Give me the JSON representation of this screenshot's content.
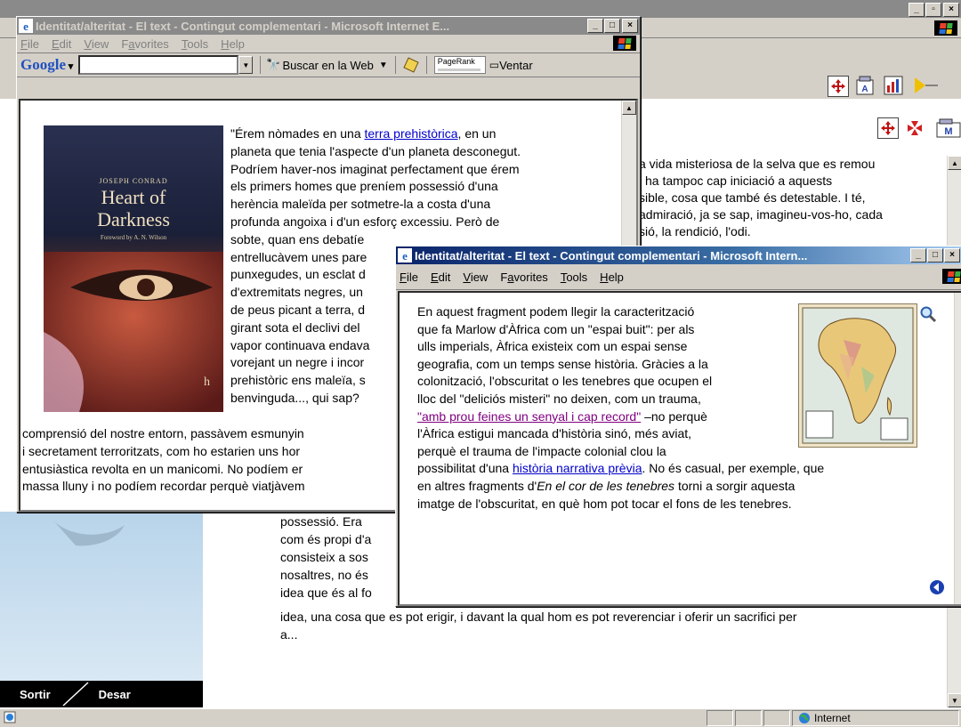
{
  "back_window": {
    "right_text": [
      "a vida misteriosa de la selva que es remou",
      "i ha tampoc cap iniciació a aquests",
      "sible, cosa que també és detestable. I té,",
      "admiració, ja se sap, imagineu-vos-ho, cada",
      "sió, la rendició, l'odi."
    ],
    "lower_text": [
      "possessió. Era",
      "com és propi d'a",
      "consisteix a sos",
      "nosaltres, no és",
      "idea que és al fo"
    ],
    "bottom_line": "idea, una cosa que es pot erigir, i davant la qual hom es pot reverenciar i oferir un sacrifici per",
    "bottom_line2": "a...",
    "btn_sortir": "Sortir",
    "btn_desar": "Desar"
  },
  "window1": {
    "title": "Identitat/alteritat - El text - Contingut complementari - Microsoft Internet E...",
    "menus": [
      "File",
      "Edit",
      "View",
      "Favorites",
      "Tools",
      "Help"
    ],
    "google_label": "Google",
    "search_value": "",
    "buscar_label": "Buscar en la Web",
    "pagerank_label": "PageRank",
    "ventana_label": "Ventar",
    "book": {
      "author": "JOSEPH CONRAD",
      "title_line1": "Heart of",
      "title_line2": "Darkness",
      "foreword": "Foreword by A. N. Wilson"
    },
    "para_start": "\"Érem nòmades en una ",
    "para_link": "terra prehistòrica",
    "para_after_link": ", en un",
    "lines": [
      "planeta que tenia l'aspecte d'un planeta desconegut.",
      "Podríem haver-nos imaginat perfectament que érem",
      "els primers homes que preníem possessió d'una",
      "herència maleïda per sotmetre-la a costa d'una",
      "profunda angoixa i d'un esforç excessiu. Però de",
      "sobte, quan ens debatíe",
      "entrellucàvem unes pare",
      "punxegudes, un esclat d",
      "d'extremitats negres, un",
      "de peus picant a terra, d",
      "girant sota el declivi del",
      "vapor continuava endava",
      "vorejant un negre i incor",
      "prehistòric ens maleïa, s",
      "benvinguda..., qui sap?"
    ],
    "wide_lines": [
      "comprensió del nostre entorn, passàvem esmunyin",
      "i secretament terroritzats, com ho estarien uns hor",
      "entusiàstica revolta en un manicomi. No podíem er",
      "massa lluny i no podíem recordar perquè viatjàvem"
    ]
  },
  "window2": {
    "title": "Identitat/alteritat - El text - Contingut complementari - Microsoft Intern...",
    "menus": [
      "File",
      "Edit",
      "View",
      "Favorites",
      "Tools",
      "Help"
    ],
    "lines": [
      "En aquest fragment podem llegir la caracterització",
      "que fa Marlow d'Àfrica com un \"espai buit\": per als",
      "ulls imperials, Àfrica existeix com un espai sense",
      "geografia, com un temps sense història. Gràcies a la",
      "colonització, l'obscuritat o les tenebres que ocupen el",
      "lloc del \"deliciós misteri\" no deixen, com un trauma,"
    ],
    "link1": "\"amb prou feines un senyal i cap record\"",
    "after_link1": " –no perquè",
    "line8": "l'Àfrica estigui mancada d'història sinó, més aviat,",
    "line9": "perquè el trauma de l'impacte colonial clou la",
    "line10_start": "possibilitat d'una ",
    "link2": "història narrativa prèvia",
    "line10_end": ". No és casual, per exemple, que",
    "line11_start": "en altres fragments d'",
    "line11_em": "En el cor de les tenebres",
    "line11_end": " torni a sorgir aquesta",
    "line12": "imatge de l'obscuritat, en què hom pot tocar el fons de les tenebres."
  },
  "statusbar": {
    "zone": "Internet"
  }
}
